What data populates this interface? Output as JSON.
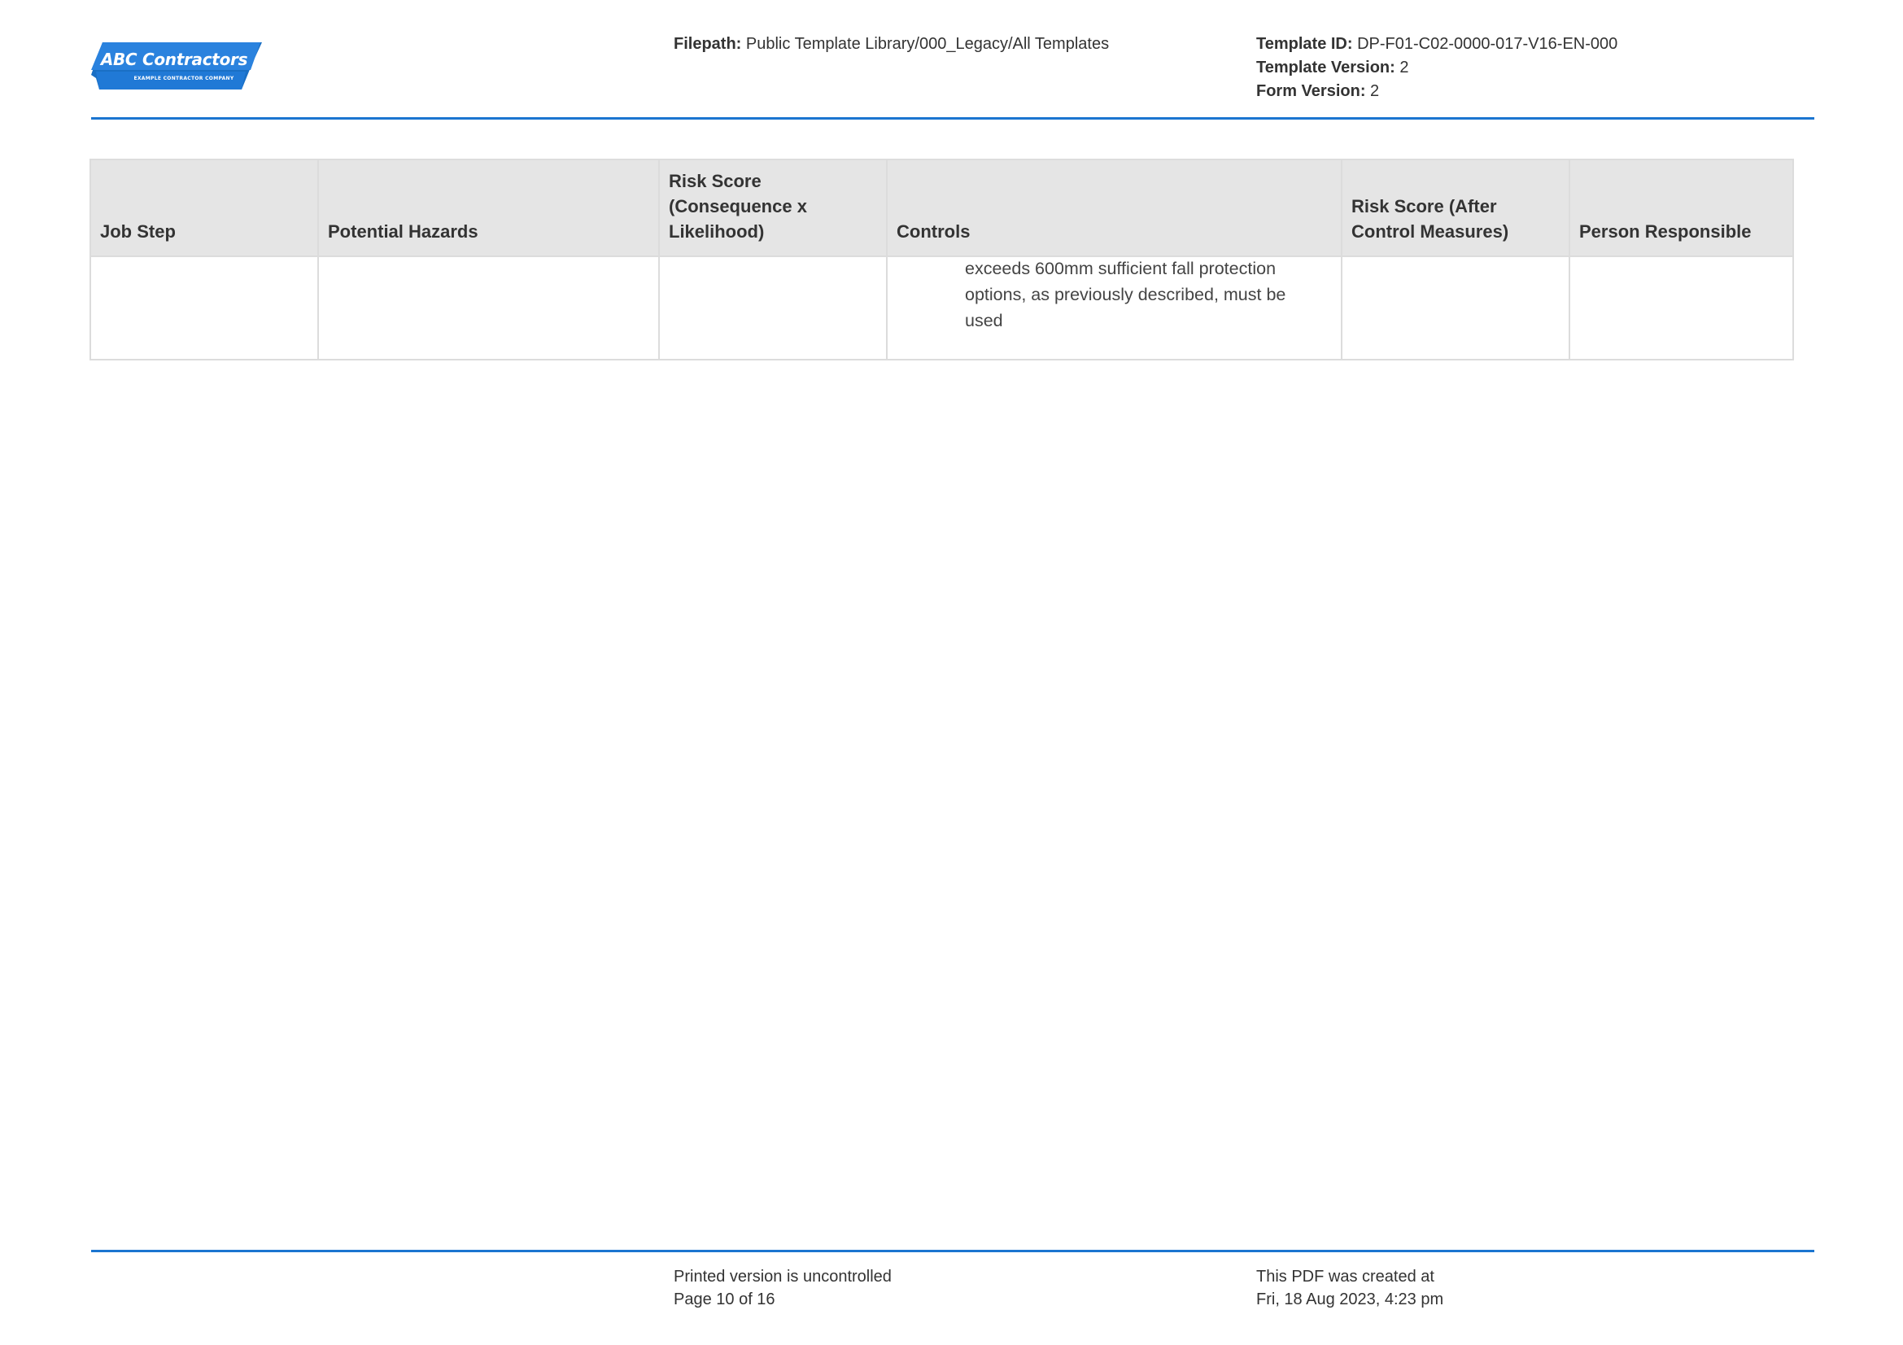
{
  "header": {
    "logo": {
      "title": "ABC Contractors",
      "subtitle": "EXAMPLE CONTRACTOR COMPANY",
      "color": "#2079d6"
    },
    "filepath_label": "Filepath:",
    "filepath_value": "Public Template Library/000_Legacy/All Templates",
    "template_id_label": "Template ID:",
    "template_id_value": "DP-F01-C02-0000-017-V16-EN-000",
    "template_version_label": "Template Version:",
    "template_version_value": "2",
    "form_version_label": "Form Version:",
    "form_version_value": "2"
  },
  "table": {
    "columns": [
      "Job Step",
      "Potential Hazards",
      "Risk Score (Consequence x Likelihood)",
      "Controls",
      "Risk Score (After Control Measures)",
      "Person Responsible"
    ],
    "rows": [
      {
        "job_step": "",
        "potential_hazards": "",
        "risk_score": "",
        "controls_lines": [
          "exceeds 600mm sufficient fall protection",
          "options, as previously described, must be",
          "used"
        ],
        "risk_score_after": "",
        "person_responsible": ""
      }
    ]
  },
  "footer": {
    "uncontrolled_note": "Printed version is uncontrolled",
    "page_label": "Page 10 of 16",
    "created_label": "This PDF was created at",
    "created_date": "Fri, 18 Aug 2023, 4:23 pm"
  },
  "colors": {
    "accent_rule": "#1b75d0",
    "table_header_bg": "#e5e5e5",
    "table_border": "#dcdcdc"
  }
}
